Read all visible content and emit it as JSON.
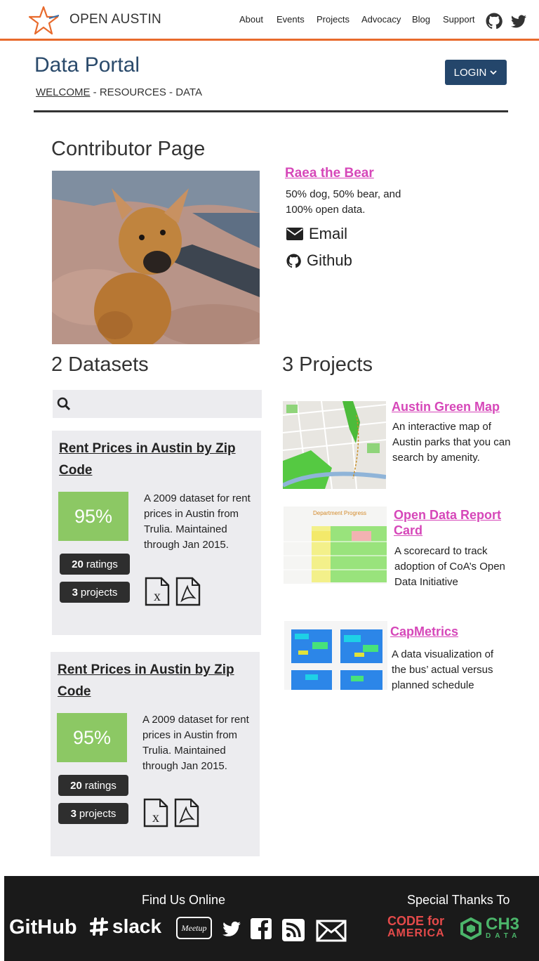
{
  "header": {
    "logo_text": "OPEN AUSTIN",
    "nav": [
      "About",
      "Events",
      "Projects",
      "Advocacy",
      "Blog",
      "Support"
    ],
    "accent_color": "#e86a2c"
  },
  "page": {
    "title": "Data Portal",
    "breadcrumb": {
      "welcome": "WELCOME",
      "rest": " - RESOURCES - DATA"
    },
    "login_label": "LOGIN"
  },
  "contributor": {
    "heading": "Contributor Page",
    "name": "Raea the Bear",
    "bio": "50% dog, 50% bear, and 100% open data.",
    "email_label": "Email",
    "github_label": "Github"
  },
  "datasets": {
    "heading": "2 Datasets",
    "search_placeholder": "",
    "items": [
      {
        "title": "Rent Prices in Austin by Zip Code",
        "score": "95%",
        "ratings_count": "20",
        "ratings_label": "ratings",
        "projects_count": "3",
        "projects_label": "projects",
        "description": "A 2009 dataset for rent prices in Austin from Trulia. Maintained through Jan 2015."
      },
      {
        "title": "Rent Prices in Austin by Zip Code",
        "score": "95%",
        "ratings_count": "20",
        "ratings_label": "ratings",
        "projects_count": "3",
        "projects_label": "projects",
        "description": "A 2009 dataset for rent prices in Austin from Trulia. Maintained through Jan 2015."
      }
    ]
  },
  "projects": {
    "heading": "3 Projects",
    "items": [
      {
        "title": "Austin Green Map",
        "description": "An interactive map of Austin parks that you can search by amenity."
      },
      {
        "title": "Open Data Report Card",
        "description": "A scorecard to track adoption of CoA’s Open Data Initiative",
        "thumb_heading": "Department Progress"
      },
      {
        "title": "CapMetrics",
        "description": "A data visualization of the bus’ actual versus planned schedule"
      }
    ]
  },
  "footer": {
    "find_us": "Find Us Online",
    "thanks": "Special Thanks To",
    "github": "GitHub",
    "slack": "slack",
    "meetup": "Meetup",
    "cfa_line1": "CODE for",
    "cfa_line2": "AMERICA",
    "ch3_line1": "CH3",
    "ch3_line2": "DATA"
  }
}
